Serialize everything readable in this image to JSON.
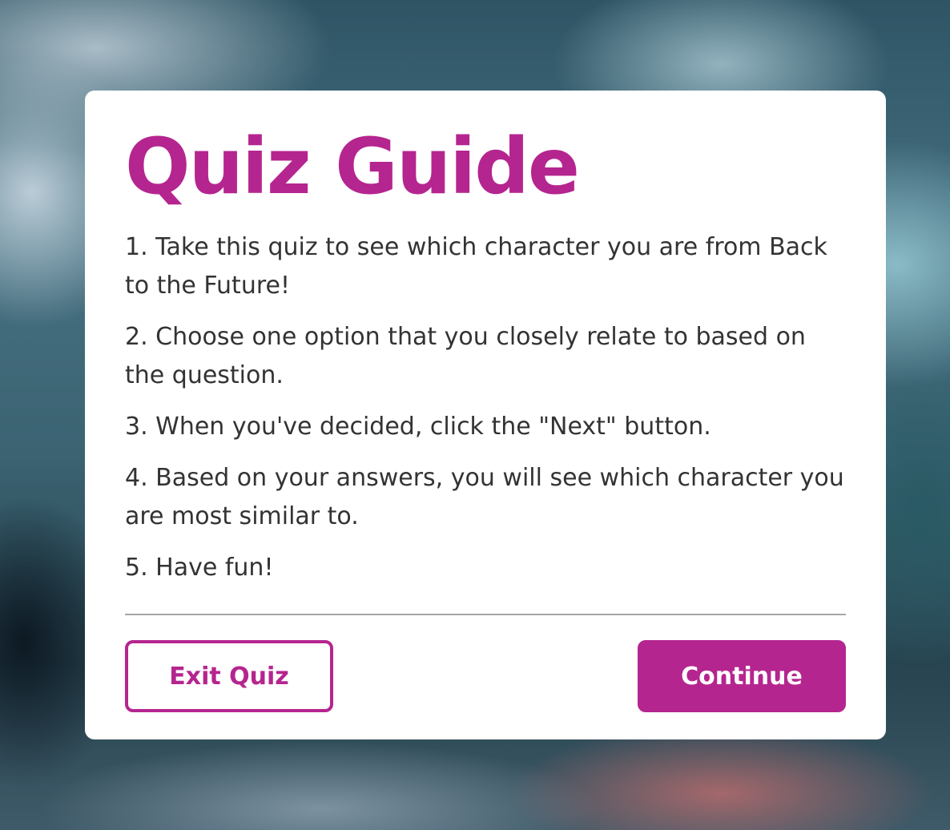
{
  "colors": {
    "accent": "#b5258f",
    "text": "#333333",
    "divider": "#a6a6a6",
    "card_background": "#ffffff"
  },
  "guide": {
    "title": "Quiz Guide",
    "rules": [
      "1. Take this quiz to see which character you are from Back to the Future!",
      "2. Choose one option that you closely relate to based on the question.",
      "3. When you've decided, click the \"Next\" button.",
      "4. Based on your answers, you will see which character you are most similar to.",
      "5. Have fun!"
    ]
  },
  "buttons": {
    "exit_label": "Exit Quiz",
    "continue_label": "Continue"
  }
}
